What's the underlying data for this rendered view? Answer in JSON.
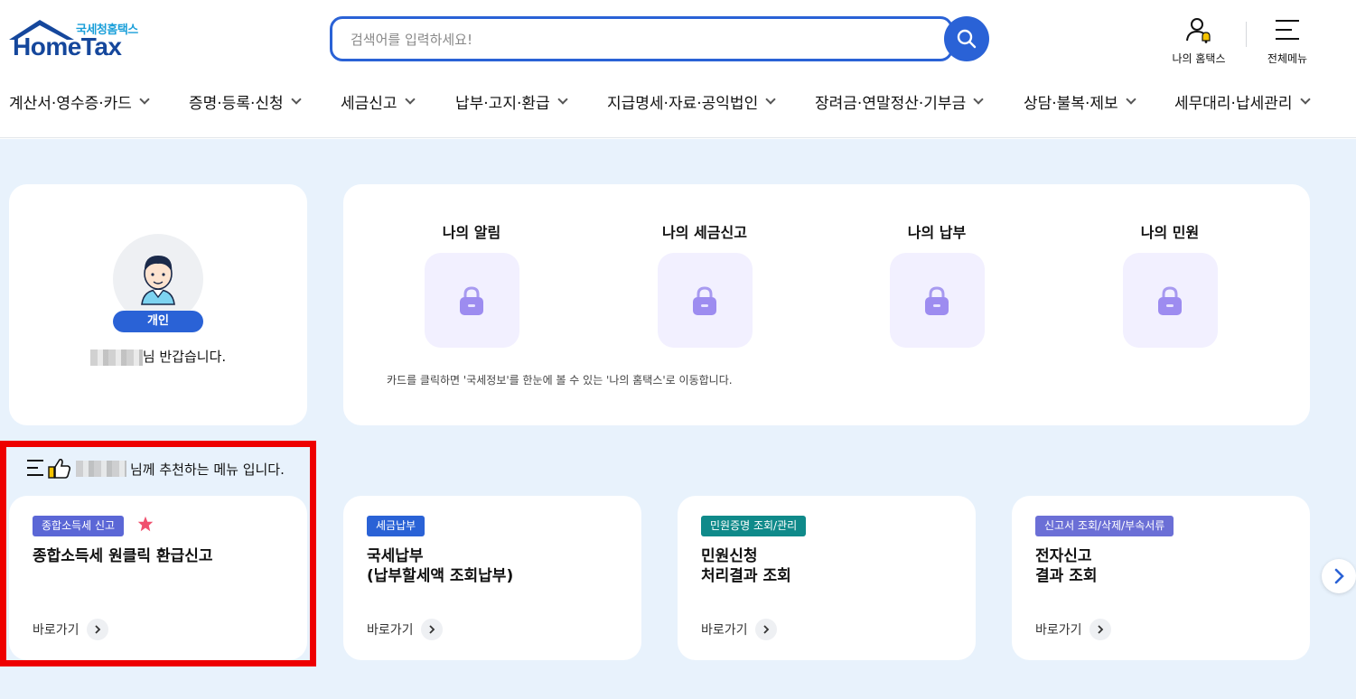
{
  "header": {
    "logo_sub": "국세청홈택스",
    "logo_main": "HomeTax",
    "search_placeholder": "검색어를 입력하세요!",
    "my_hometax_label": "나의 홈택스",
    "all_menu_label": "전체메뉴"
  },
  "gnb": {
    "items": [
      {
        "label": "계산서·영수증·카드"
      },
      {
        "label": "증명·등록·신청"
      },
      {
        "label": "세금신고"
      },
      {
        "label": "납부·고지·환급"
      },
      {
        "label": "지급명세·자료·공익법인"
      },
      {
        "label": "장려금·연말정산·기부금"
      },
      {
        "label": "상담·불복·제보"
      },
      {
        "label": "세무대리·납세관리"
      }
    ]
  },
  "profile": {
    "badge": "개인",
    "greeting_suffix": "님 반갑습니다."
  },
  "mine": {
    "items": [
      {
        "title": "나의 알림"
      },
      {
        "title": "나의 세금신고"
      },
      {
        "title": "나의 납부"
      },
      {
        "title": "나의 민원"
      }
    ],
    "notice": "카드를 클릭하면 '국세정보'를 한눈에 볼 수 있는 '나의 홈택스'로 이동합니다."
  },
  "recommend": {
    "heading_suffix": "님께 추천하는 메뉴 입니다.",
    "go_label": "바로가기",
    "cards": [
      {
        "tag": "종합소득세 신고",
        "tag_color": "#5b67d6",
        "title": "종합소득세 원클릭 환급신고",
        "starred": true
      },
      {
        "tag": "세금납부",
        "tag_color": "#2a62d6",
        "title": "국세납부\n(납부할세액 조회납부)"
      },
      {
        "tag": "민원증명 조회/관리",
        "tag_color": "#0f8a8a",
        "title": "민원신청\n처리결과 조회"
      },
      {
        "tag": "신고서 조회/삭제/부속서류",
        "tag_color": "#6b6fd6",
        "title": "전자신고\n결과 조회"
      }
    ]
  },
  "colors": {
    "primary": "#2a62d6",
    "highlight_border": "#ee0000",
    "main_bg": "#e8f2fc",
    "star": "#f0506e"
  }
}
